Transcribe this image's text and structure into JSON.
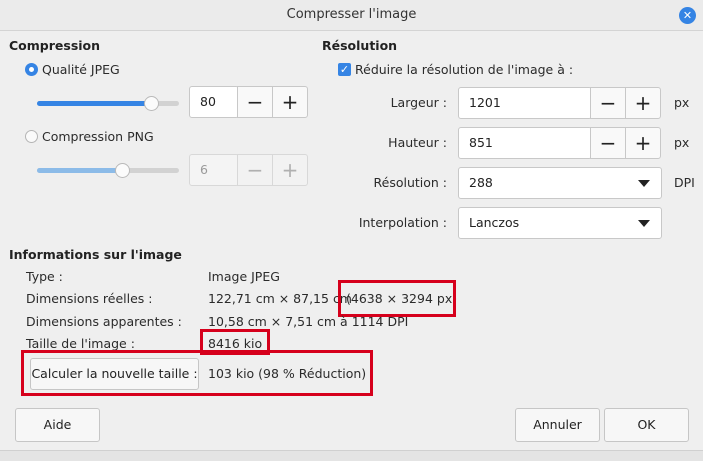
{
  "window": {
    "title": "Compresser l'image",
    "close_glyph": "✕"
  },
  "compression": {
    "section_title": "Compression",
    "jpeg": {
      "label": "Qualité JPEG",
      "selected": true,
      "value": "80",
      "slider_fraction": 0.8,
      "minus": "−",
      "plus": "+"
    },
    "png": {
      "label": "Compression PNG",
      "selected": false,
      "value": "6",
      "slider_fraction": 0.6,
      "minus": "−",
      "plus": "+"
    }
  },
  "resolution": {
    "section_title": "Résolution",
    "reduce_label": "Réduire la résolution de l'image à :",
    "reduce_checked": true,
    "check_glyph": "✓",
    "width_label": "Largeur :",
    "width_value": "1201",
    "width_unit": "px",
    "height_label": "Hauteur :",
    "height_value": "851",
    "height_unit": "px",
    "dpi_label": "Résolution :",
    "dpi_value": "288",
    "dpi_unit": "DPI",
    "interp_label": "Interpolation :",
    "interp_value": "Lanczos",
    "minus": "−",
    "plus": "+"
  },
  "info": {
    "section_title": "Informations sur l'image",
    "type_label": "Type :",
    "type_value": "Image JPEG",
    "real_dim_label": "Dimensions réelles :",
    "real_dim_value": "122,71 cm × 87,15 cm",
    "real_dim_px": "(4638 × 3294 px)",
    "apparent_dim_label": "Dimensions apparentes :",
    "apparent_dim_value": "10,58 cm × 7,51 cm à 1114 DPI",
    "size_label": "Taille de l'image :",
    "size_value": "8416 kio",
    "calc_button": "Calculer la nouvelle taille :",
    "new_size_value": "103 kio (98 % Réduction)"
  },
  "footer": {
    "help_button": "Aide",
    "cancel_button": "Annuler",
    "ok_button": "OK"
  },
  "colors": {
    "accent": "#3584e4",
    "slider_fill": "#3584e4",
    "slider_fill_disabled": "#8cbbe8",
    "highlight": "#d6001c"
  }
}
